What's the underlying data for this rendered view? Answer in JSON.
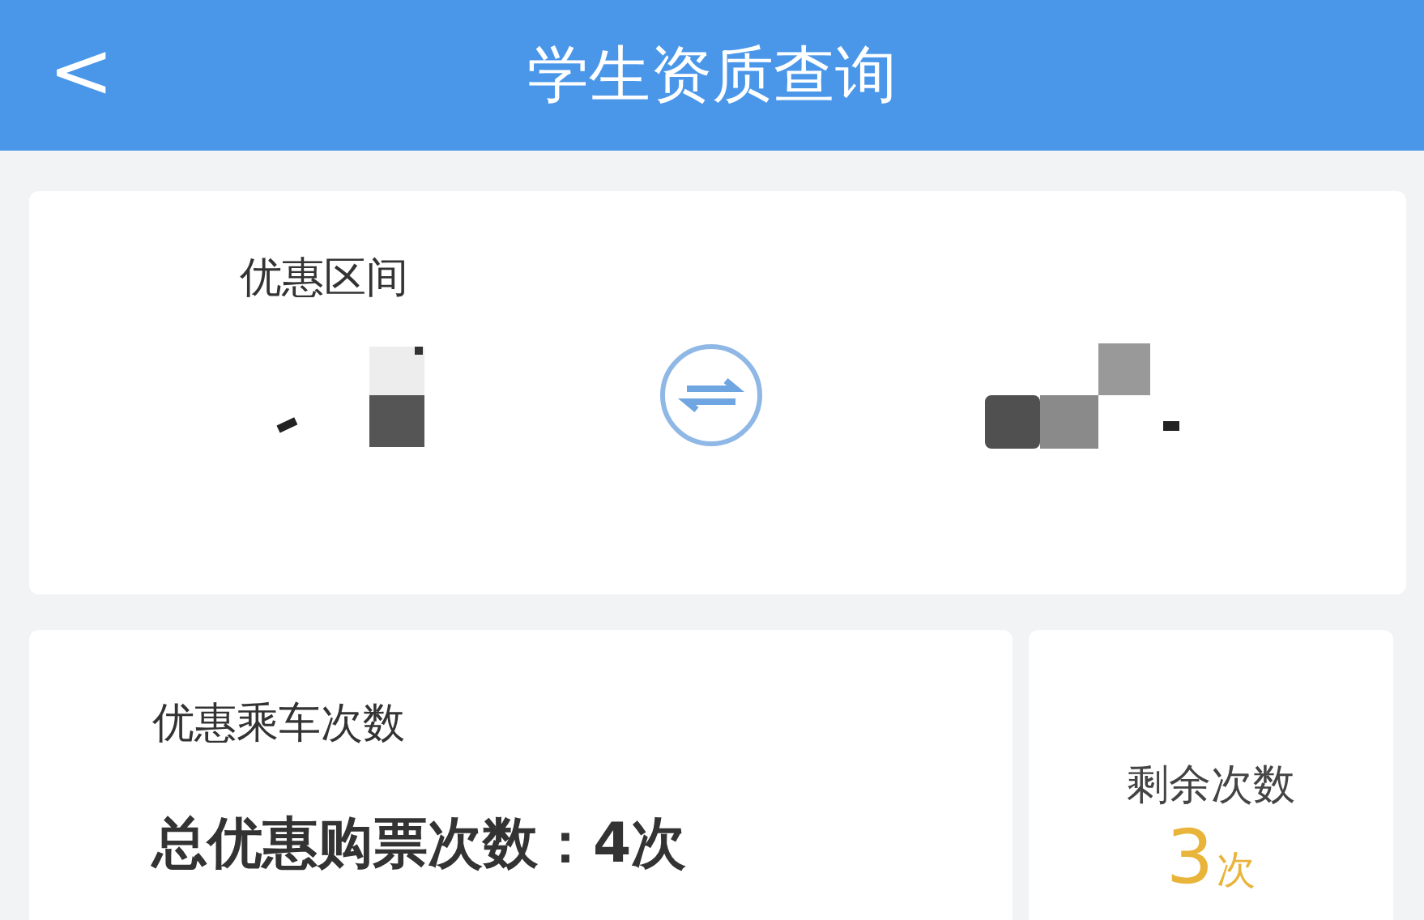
{
  "header": {
    "back": "<",
    "title": "学生资质查询"
  },
  "route": {
    "label": "优惠区间"
  },
  "rides": {
    "label": "优惠乘车次数",
    "total": "总优惠购票次数：4次"
  },
  "remaining": {
    "label": "剩余次数",
    "count": "3",
    "unit": "次"
  }
}
